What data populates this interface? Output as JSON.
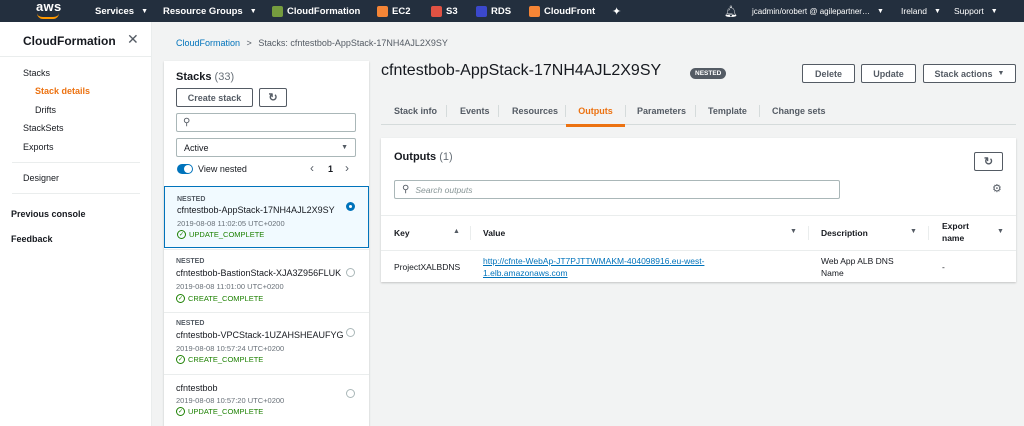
{
  "topnav": {
    "logo": "aws",
    "services": "Services",
    "resource_groups": "Resource Groups",
    "shortcuts": [
      {
        "label": "CloudFormation",
        "icon": "cloudformation-icon",
        "color": "#759c3e"
      },
      {
        "label": "EC2",
        "icon": "ec2-icon",
        "color": "#f58536"
      },
      {
        "label": "S3",
        "icon": "s3-icon",
        "color": "#e05243"
      },
      {
        "label": "RDS",
        "icon": "rds-icon",
        "color": "#3b48cc"
      },
      {
        "label": "CloudFront",
        "icon": "cloudfront-icon",
        "color": "#f58536"
      }
    ],
    "account": "jcadmin/orobert @ agilepartner…",
    "region": "Ireland",
    "support": "Support"
  },
  "sidebar": {
    "title": "CloudFormation",
    "items": {
      "stacks": "Stacks",
      "stack_details": "Stack details",
      "drifts": "Drifts",
      "stacksets": "StackSets",
      "exports": "Exports",
      "designer": "Designer",
      "previous_console": "Previous console",
      "feedback": "Feedback"
    }
  },
  "breadcrumb": {
    "root": "CloudFormation",
    "separator": ">",
    "current": "Stacks: cfntestbob-AppStack-17NH4AJL2X9SY"
  },
  "stacks_panel": {
    "title": "Stacks",
    "count": "(33)",
    "create_button": "Create stack",
    "filter_value": "Active",
    "view_nested": "View nested",
    "page": "1",
    "items": [
      {
        "nested": "NESTED",
        "name": "cfntestbob-AppStack-17NH4AJL2X9SY",
        "date": "2019-08-08 11:02:05 UTC+0200",
        "status": "UPDATE_COMPLETE"
      },
      {
        "nested": "NESTED",
        "name": "cfntestbob-BastionStack-XJA3Z956FLUK",
        "date": "2019-08-08 11:01:00 UTC+0200",
        "status": "CREATE_COMPLETE"
      },
      {
        "nested": "NESTED",
        "name": "cfntestbob-VPCStack-1UZAHSHEAUFYG",
        "date": "2019-08-08 10:57:24 UTC+0200",
        "status": "CREATE_COMPLETE"
      },
      {
        "nested": "",
        "name": "cfntestbob",
        "date": "2019-08-08 10:57:20 UTC+0200",
        "status": "UPDATE_COMPLETE"
      }
    ]
  },
  "main": {
    "title": "cfntestbob-AppStack-17NH4AJL2X9SY",
    "badge": "NESTED",
    "actions": {
      "delete": "Delete",
      "update": "Update",
      "stack_actions": "Stack actions"
    },
    "tabs": [
      "Stack info",
      "Events",
      "Resources",
      "Outputs",
      "Parameters",
      "Template",
      "Change sets"
    ],
    "active_tab": "Outputs"
  },
  "outputs": {
    "title": "Outputs",
    "count": "(1)",
    "search_placeholder": "Search outputs",
    "columns": {
      "key": "Key",
      "value": "Value",
      "description": "Description",
      "export_name_1": "Export",
      "export_name_2": "name"
    },
    "rows": [
      {
        "key": "ProjectXALBDNS",
        "value_line1": "http://cfnte-WebAp-JT7PJTTWMAKM-404098916.eu-west-",
        "value_line2": "1.elb.amazonaws.com",
        "description_line1": "Web App ALB DNS",
        "description_line2": "Name",
        "export_name": "-"
      }
    ]
  },
  "colors": {
    "nav_bg": "#232f3e",
    "accent_orange": "#ec7211",
    "link_blue": "#0073bb",
    "success_green": "#1d8102"
  }
}
